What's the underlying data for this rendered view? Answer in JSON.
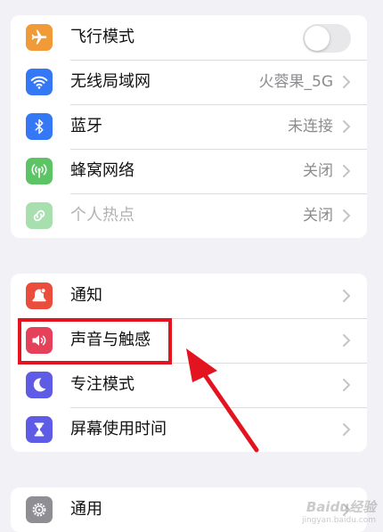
{
  "groups": [
    {
      "rows": [
        {
          "icon": "airplane-icon",
          "icon_color": "#F19A38",
          "label": "飞行模式",
          "control": "toggle",
          "toggle_on": false
        },
        {
          "icon": "wifi-icon",
          "icon_color": "#3478F6",
          "label": "无线局域网",
          "value": "火蓉果_5G",
          "control": "chevron"
        },
        {
          "icon": "bluetooth-icon",
          "icon_color": "#3478F6",
          "label": "蓝牙",
          "value": "未连接",
          "control": "chevron"
        },
        {
          "icon": "cellular-icon",
          "icon_color": "#5DC466",
          "label": "蜂窝网络",
          "value": "关闭",
          "control": "chevron"
        },
        {
          "icon": "hotspot-icon",
          "icon_color": "#A8DFAE",
          "label": "个人热点",
          "value": "关闭",
          "control": "chevron",
          "dimmed": true
        }
      ]
    },
    {
      "rows": [
        {
          "icon": "bell-icon",
          "icon_color": "#EB4D3D",
          "label": "通知",
          "control": "chevron"
        },
        {
          "icon": "speaker-icon",
          "icon_color": "#E5415A",
          "label": "声音与触感",
          "control": "chevron",
          "highlighted": true
        },
        {
          "icon": "moon-icon",
          "icon_color": "#5E5CE6",
          "label": "专注模式",
          "control": "chevron"
        },
        {
          "icon": "hourglass-icon",
          "icon_color": "#5E5CE6",
          "label": "屏幕使用时间",
          "control": "chevron"
        }
      ]
    },
    {
      "rows": [
        {
          "icon": "gear-icon",
          "icon_color": "#8E8E93",
          "label": "通用",
          "control": "chevron"
        }
      ]
    }
  ],
  "annotation": {
    "box_color": "#E3141F",
    "arrow_color": "#E3141F"
  },
  "watermark": {
    "text": "Baidu经验",
    "url": "jingyan.baidu.com"
  }
}
